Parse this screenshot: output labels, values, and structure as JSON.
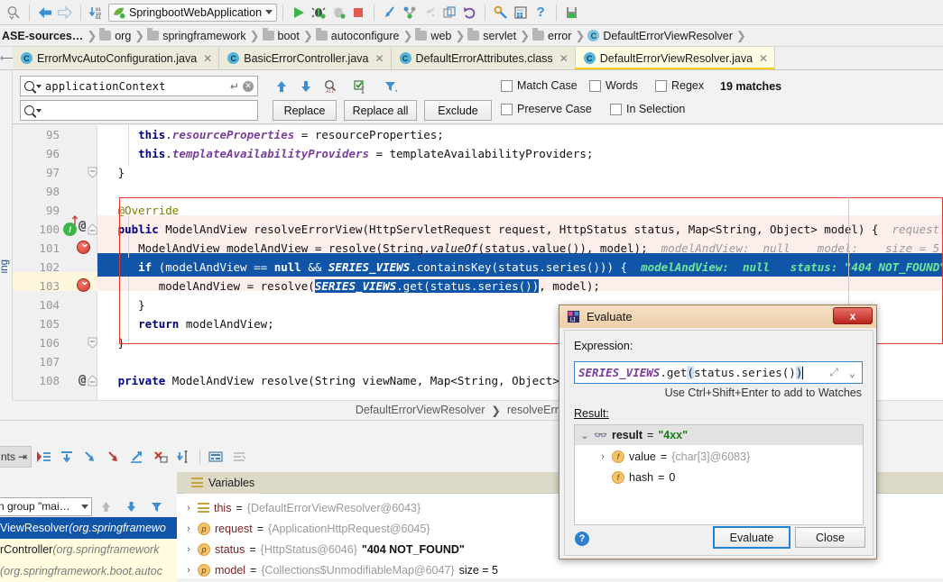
{
  "toolbar": {
    "run_config": "SpringbootWebApplication",
    "icons": [
      {
        "name": "find-toolbar-icon",
        "glyph": "search"
      },
      {
        "name": "back-arrow-icon",
        "glyph": "←"
      },
      {
        "name": "forward-arrow-icon",
        "glyph": "→"
      },
      {
        "name": "download-sources-icon",
        "glyph": "↓"
      },
      {
        "name": "run-icon",
        "glyph": "▶"
      },
      {
        "name": "debug-icon",
        "glyph": "bug"
      },
      {
        "name": "run-coverage-icon",
        "glyph": "coverage"
      },
      {
        "name": "stop-icon",
        "glyph": "■"
      },
      {
        "name": "step-into-icon",
        "glyph": "↙"
      },
      {
        "name": "branch-icon",
        "glyph": "Y"
      },
      {
        "name": "step-out-icon",
        "glyph": "↗"
      },
      {
        "name": "copy-icon",
        "glyph": "copy"
      },
      {
        "name": "undo-icon",
        "glyph": "↺"
      },
      {
        "name": "settings-wrench-icon",
        "glyph": "wrench"
      },
      {
        "name": "structure-icon",
        "glyph": "grid"
      },
      {
        "name": "help-icon",
        "glyph": "?"
      },
      {
        "name": "save-all-icon",
        "glyph": "save"
      }
    ]
  },
  "breadcrumb": [
    {
      "label": "ASE-sources…",
      "icon": "none",
      "bold": true
    },
    {
      "label": "org",
      "icon": "folder"
    },
    {
      "label": "springframework",
      "icon": "folder"
    },
    {
      "label": "boot",
      "icon": "folder"
    },
    {
      "label": "autoconfigure",
      "icon": "folder"
    },
    {
      "label": "web",
      "icon": "folder"
    },
    {
      "label": "servlet",
      "icon": "folder"
    },
    {
      "label": "error",
      "icon": "folder"
    },
    {
      "label": "DefaultErrorViewResolver",
      "icon": "class"
    }
  ],
  "tabs": [
    {
      "label": "ErrorMvcAutoConfiguration.java",
      "active": false
    },
    {
      "label": "BasicErrorController.java",
      "active": false
    },
    {
      "label": "DefaultErrorAttributes.class",
      "active": false
    },
    {
      "label": "DefaultErrorViewResolver.java",
      "active": true
    }
  ],
  "find": {
    "search_value": "applicationContext",
    "replace_value": "",
    "replace_label": "Replace",
    "replace_all_label": "Replace all",
    "exclude_label": "Exclude",
    "match_case_label": "Match Case",
    "words_label": "Words",
    "regex_label": "Regex",
    "preserve_case_label": "Preserve Case",
    "in_selection_label": "In Selection",
    "matches_label": "19 matches",
    "prev_icon": "arrow-up-icon",
    "next_icon": "arrow-down-icon",
    "find_all_icon": "find-all-icon",
    "select_all_icon": "select-all-occurrences-icon",
    "filter_icon": "filter-icon",
    "close_icon": "clear-search-icon"
  },
  "editor": {
    "lines": [
      {
        "num": "95",
        "text": "            this.resourceProperties = resourceProperties;"
      },
      {
        "num": "96",
        "text": "            this.templateAvailabilityProviders = templateAvailabilityProviders;"
      },
      {
        "num": "97",
        "text": "        }"
      },
      {
        "num": "98",
        "text": ""
      },
      {
        "num": "99",
        "text": "        @Override"
      },
      {
        "num": "100",
        "text": "        public ModelAndView resolveErrorView(HttpServletRequest request, HttpStatus status, Map<String, Object> model) {"
      },
      {
        "num": "101",
        "text": "            ModelAndView modelAndView = resolve(String.valueOf(status.value()), model);"
      },
      {
        "num": "102",
        "text": "            if (modelAndView == null && SERIES_VIEWS.containsKey(status.series())) {"
      },
      {
        "num": "103",
        "text": "                modelAndView = resolve(SERIES_VIEWS.get(status.series()), model);"
      },
      {
        "num": "104",
        "text": "            }"
      },
      {
        "num": "105",
        "text": "            return modelAndView;"
      },
      {
        "num": "106",
        "text": "        }"
      },
      {
        "num": "107",
        "text": ""
      },
      {
        "num": "108",
        "text": "        private ModelAndView resolve(String viewName, Map<String, Object> mo"
      }
    ],
    "inline_hints": {
      "line100": "request:  Applic…",
      "line101": "modelAndView:  null    model:    size = 5",
      "line102_a": "modelAndView:  null",
      "line102_b": "status:",
      "line102_c": "\"404 NOT_FOUND\""
    },
    "status_class": "DefaultErrorViewResolver",
    "status_method": "resolveErrorView()"
  },
  "debug": {
    "left_tab_label": "nts",
    "frames_thread": "n group \"mai…",
    "frames": [
      {
        "name": "ViewResolver ",
        "pkg": "(org.springframewo",
        "selected": true
      },
      {
        "name": "rController ",
        "pkg": "(org.springframework",
        "selected": false
      },
      {
        "name": "",
        "pkg": "(org.springframework.boot.autoc",
        "selected": false
      }
    ],
    "variables_tab": "Variables",
    "variables": [
      {
        "icon": "this-icon",
        "name": "this",
        "eq": "=",
        "value": "{DefaultErrorViewResolver@6043}",
        "extra": ""
      },
      {
        "icon": "p",
        "name": "request",
        "eq": "=",
        "value": "{ApplicationHttpRequest@6045}",
        "extra": ""
      },
      {
        "icon": "p",
        "name": "status",
        "eq": "=",
        "value": "{HttpStatus@6046}",
        "extra": "\"404 NOT_FOUND\""
      },
      {
        "icon": "p",
        "name": "model",
        "eq": "=",
        "value": "{Collections$UnmodifiableMap@6047}",
        "extra": "size = 5"
      }
    ]
  },
  "evaluate_dialog": {
    "title": "Evaluate",
    "close_label": "x",
    "expression_label": "Expression:",
    "expression_prefix": "SERIES_VIEWS",
    "expression_mid": ".get",
    "expression_open": "(",
    "expression_arg": "status.series()",
    "expression_close": ")",
    "hint": "Use Ctrl+Shift+Enter to add to Watches",
    "result_label": "Result:",
    "result_rows": [
      {
        "indent": 0,
        "expander": "⌄",
        "icon": "result-glasses-icon",
        "name": "result",
        "eq": "=",
        "value": "\"4xx\"",
        "value_kind": "string"
      },
      {
        "indent": 1,
        "expander": "›",
        "icon": "f",
        "name": "value",
        "eq": "=",
        "value": "{char[3]@6083}",
        "value_kind": "ref"
      },
      {
        "indent": 1,
        "expander": "",
        "icon": "f",
        "name": "hash",
        "eq": "=",
        "value": "0",
        "value_kind": "num"
      }
    ],
    "help_label": "?",
    "evaluate_button": "Evaluate",
    "close_button": "Close"
  },
  "side_vertical_label": "ing",
  "colors": {
    "accent_blue": "#1155a8",
    "keyword": "#000080",
    "static_field": "#7a3e9d",
    "hint_gray": "#9a9a9a",
    "hint_green": "#1a9a4b",
    "tab_active": "#fffde4",
    "red_box": "#e33a2e",
    "breakpoint": "#d0392b"
  }
}
